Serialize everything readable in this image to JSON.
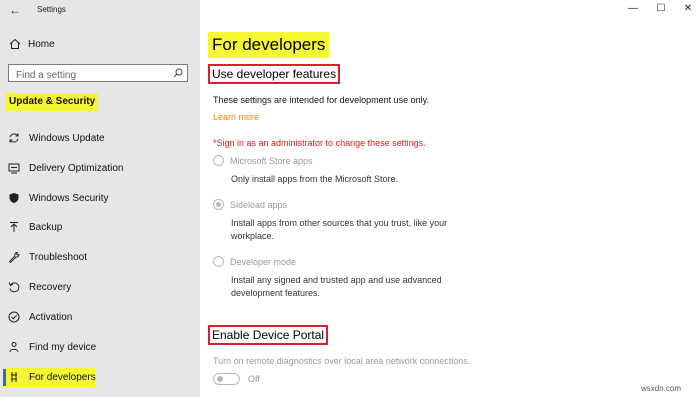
{
  "window": {
    "title": "Settings",
    "controls": {
      "minimize": "—",
      "maximize": "☐",
      "close": "✕"
    }
  },
  "sidebar": {
    "home_label": "Home",
    "search_placeholder": "Find a setting",
    "section_heading": "Update & Security",
    "items": [
      {
        "label": "Windows Update",
        "icon": "sync-icon"
      },
      {
        "label": "Delivery Optimization",
        "icon": "delivery-optimization-icon"
      },
      {
        "label": "Windows Security",
        "icon": "shield-icon"
      },
      {
        "label": "Backup",
        "icon": "backup-arrow-icon"
      },
      {
        "label": "Troubleshoot",
        "icon": "wrench-icon"
      },
      {
        "label": "Recovery",
        "icon": "recovery-icon"
      },
      {
        "label": "Activation",
        "icon": "check-circle-icon"
      },
      {
        "label": "Find my device",
        "icon": "person-pin-icon"
      },
      {
        "label": "For developers",
        "icon": "developer-tools-icon",
        "active": true
      }
    ]
  },
  "main": {
    "title": "For developers",
    "dev_features": {
      "heading": "Use developer features",
      "intro": "These settings are intended for development use only.",
      "learn_more": "Learn more",
      "admin_warning": "*Sign in as an administrator to change these settings.",
      "options": [
        {
          "label": "Microsoft Store apps",
          "description": "Only install apps from the Microsoft Store.",
          "checked": false
        },
        {
          "label": "Sideload apps",
          "description": "Install apps from other sources that you trust, like your workplace.",
          "checked": true
        },
        {
          "label": "Developer mode",
          "description": "Install any signed and trusted app and use advanced development features.",
          "checked": false
        }
      ]
    },
    "device_portal": {
      "heading": "Enable Device Portal",
      "description": "Turn on remote diagnostics over local area network connections.",
      "toggle_label": "Off",
      "toggle_on": false
    }
  },
  "watermark": "wsxdn.com",
  "colors": {
    "highlight": "#f5f735",
    "red_box": "#d9202c",
    "link": "#e08a00",
    "warning": "#d42020",
    "accent": "#2a6ccb"
  }
}
